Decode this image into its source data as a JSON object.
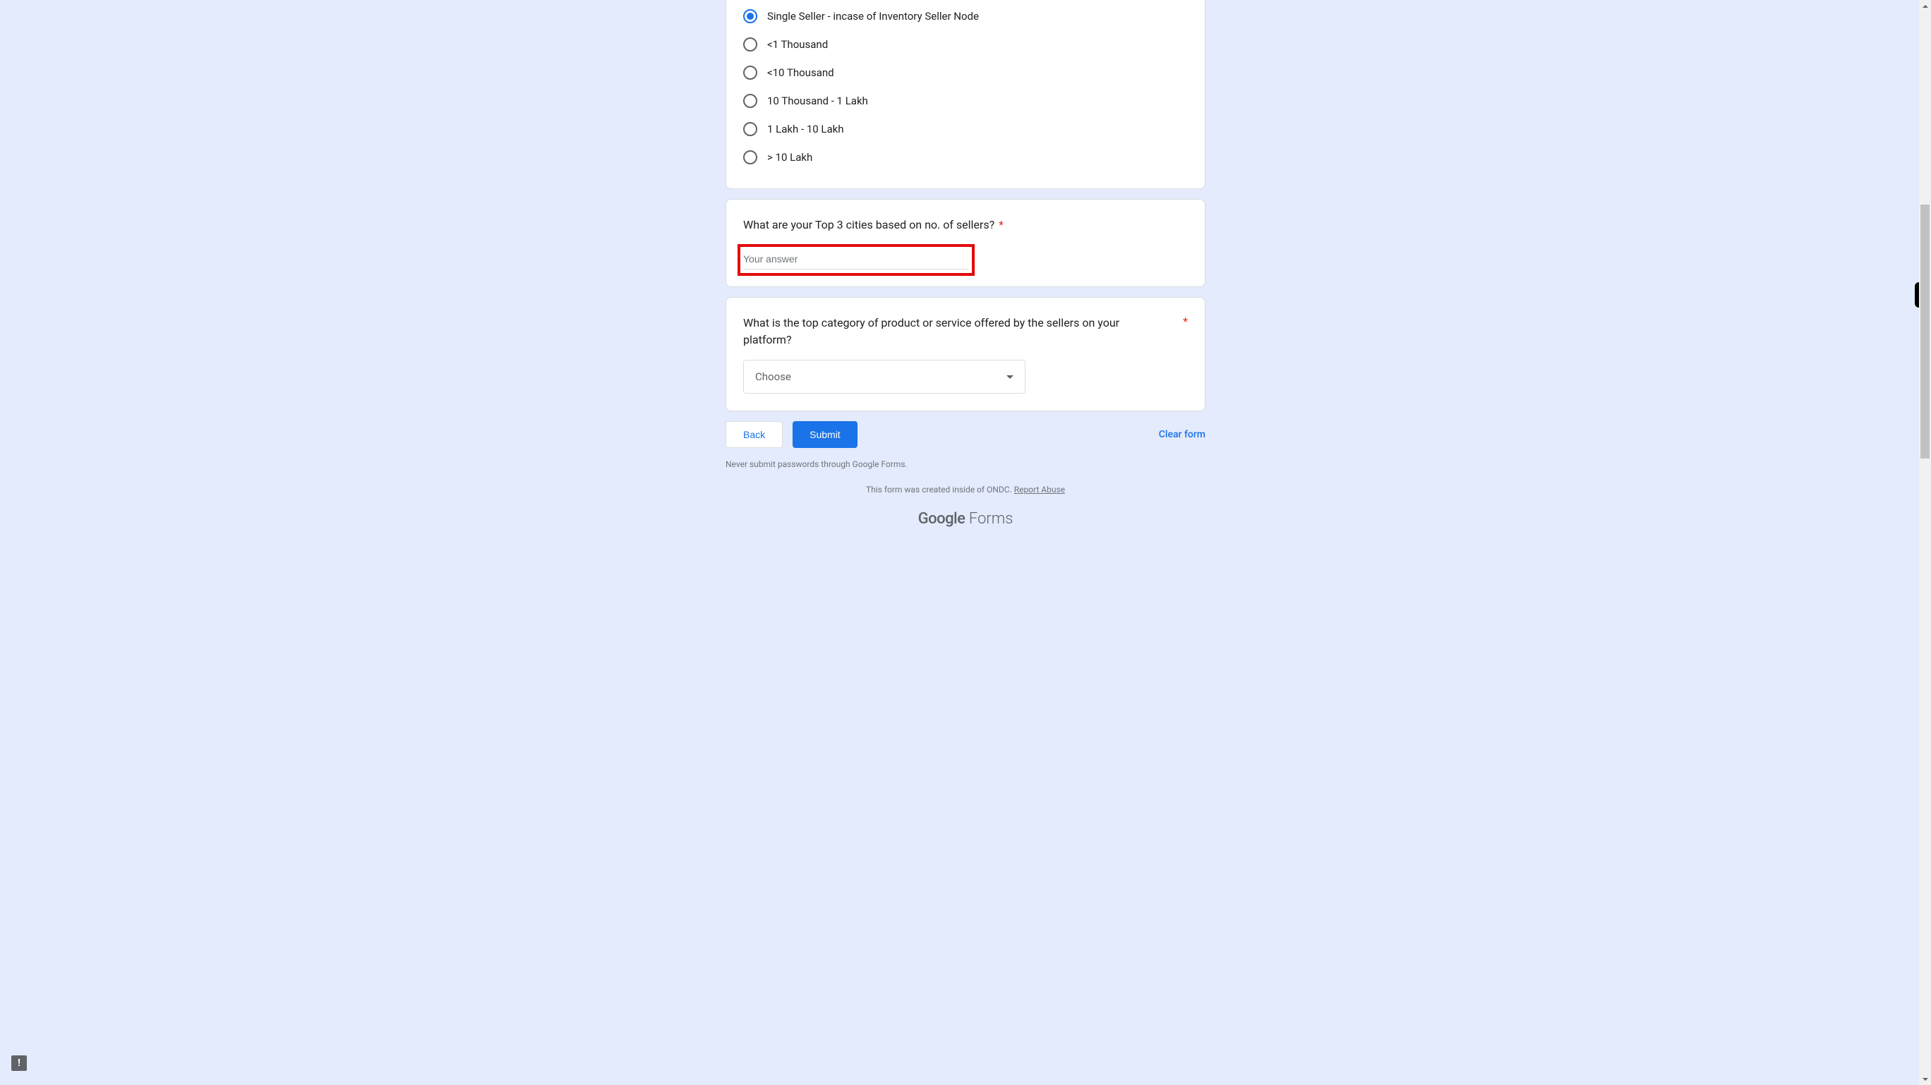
{
  "question1": {
    "options": [
      {
        "label": "Single Seller - incase of Inventory Seller Node",
        "selected": true
      },
      {
        "label": "<1 Thousand",
        "selected": false
      },
      {
        "label": "<10 Thousand",
        "selected": false
      },
      {
        "label": "10 Thousand - 1 Lakh",
        "selected": false
      },
      {
        "label": "1 Lakh - 10 Lakh",
        "selected": false
      },
      {
        "label": "> 10 Lakh",
        "selected": false
      }
    ]
  },
  "question2": {
    "title": "What are your Top 3 cities based on no. of sellers?",
    "required": "*",
    "placeholder": "Your answer"
  },
  "question3": {
    "title": "What is the top category of product or service offered by the sellers on your platform?",
    "required": "*",
    "dropdown_placeholder": "Choose"
  },
  "buttons": {
    "back": "Back",
    "submit": "Submit",
    "clear": "Clear form"
  },
  "disclaimer": "Never submit passwords through Google Forms.",
  "footer": {
    "text_prefix": "This form was created inside of ONDC. ",
    "report_link": "Report Abuse"
  },
  "logo": {
    "google": "Google",
    "forms": " Forms"
  }
}
